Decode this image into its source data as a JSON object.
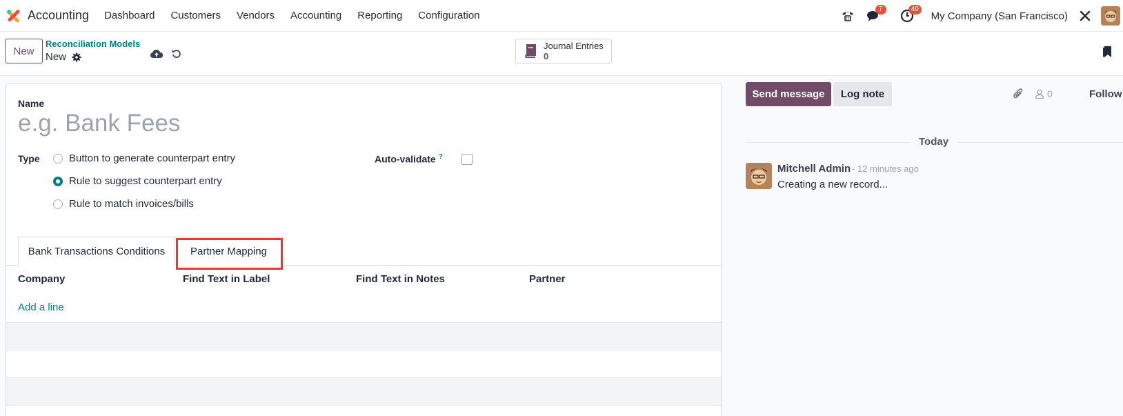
{
  "navbar": {
    "app_title": "Accounting",
    "menu": [
      "Dashboard",
      "Customers",
      "Vendors",
      "Accounting",
      "Reporting",
      "Configuration"
    ],
    "messages_badge": "7",
    "activities_badge": "40",
    "company": "My Company (San Francisco)"
  },
  "control": {
    "new_label": "New",
    "breadcrumb": "Reconciliation Models",
    "record_name": "New",
    "smart_button": {
      "label": "Journal Entries",
      "count": "0"
    }
  },
  "form": {
    "name_label": "Name",
    "name_placeholder": "e.g. Bank Fees",
    "type_label": "Type",
    "type_options": [
      {
        "label": "Button to generate counterpart entry",
        "selected": false
      },
      {
        "label": "Rule to suggest counterpart entry",
        "selected": true
      },
      {
        "label": "Rule to match invoices/bills",
        "selected": false
      }
    ],
    "auto_validate_label": "Auto-validate",
    "auto_validate_help": "?",
    "tabs": [
      "Bank Transactions Conditions",
      "Partner Mapping"
    ],
    "active_tab": "Partner Mapping",
    "columns": [
      "Company",
      "Find Text in Label",
      "Find Text in Notes",
      "Partner"
    ],
    "add_line": "Add a line"
  },
  "chatter": {
    "send_message": "Send message",
    "log_note": "Log note",
    "followers_count": "0",
    "follow": "Follow",
    "date_separator": "Today",
    "message": {
      "author": "Mitchell Admin",
      "time": "- 12 minutes ago",
      "body": "Creating a new record..."
    }
  },
  "colors": {
    "primary": "#714b67",
    "link": "#017e84",
    "badge": "#e8503e",
    "highlight": "#e53935"
  }
}
